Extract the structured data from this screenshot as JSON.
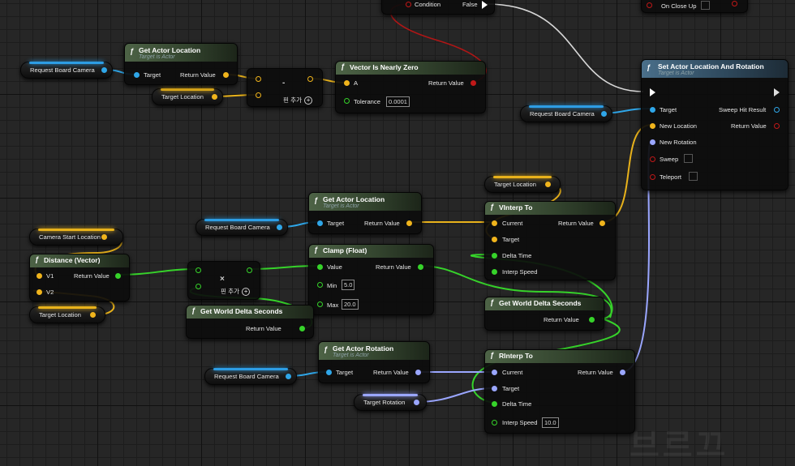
{
  "graph": {
    "n_getloc1": {
      "title": "Get Actor Location",
      "subtitle": "Target is Actor",
      "in_target": "Target",
      "out_return": "Return Value"
    },
    "n_add1": {
      "label": "핀 추가"
    },
    "n_nearlyzero": {
      "title": "Vector Is Nearly Zero",
      "in_a": "A",
      "in_tol": "Tolerance",
      "tol_value": "0.0001",
      "out_return": "Return Value"
    },
    "n_branch": {
      "condition": "Condition",
      "false": "False"
    },
    "n_close": {
      "label": "On Close Up"
    },
    "n_setloc": {
      "title": "Set Actor Location And Rotation",
      "subtitle": "Target is Actor",
      "target": "Target",
      "new_location": "New Location",
      "new_rotation": "New Rotation",
      "sweep": "Sweep",
      "teleport": "Teleport",
      "sweep_hit": "Sweep Hit Result",
      "return": "Return Value"
    },
    "n_getloc2": {
      "title": "Get Actor Location",
      "subtitle": "Target is Actor",
      "in_target": "Target",
      "out_return": "Return Value"
    },
    "n_vinterp": {
      "title": "VInterp To",
      "current": "Current",
      "target": "Target",
      "delta": "Delta Time",
      "speed": "Interp Speed",
      "return": "Return Value"
    },
    "n_distance": {
      "title": "Distance (Vector)",
      "v1": "V1",
      "v2": "V2",
      "return": "Return Value"
    },
    "n_add2": {
      "label": "핀 추가"
    },
    "n_clamp": {
      "title": "Clamp (Float)",
      "value": "Value",
      "min": "Min",
      "min_value": "5.0",
      "max": "Max",
      "max_value": "20.0",
      "return": "Return Value"
    },
    "n_delta1": {
      "title": "Get World Delta Seconds",
      "return": "Return Value"
    },
    "n_delta2": {
      "title": "Get World Delta Seconds",
      "return": "Return Value"
    },
    "n_getrot": {
      "title": "Get Actor Rotation",
      "subtitle": "Target is Actor",
      "target": "Target",
      "return": "Return Value"
    },
    "n_rinterp": {
      "title": "RInterp To",
      "current": "Current",
      "target": "Target",
      "delta": "Delta Time",
      "speed": "Interp Speed",
      "speed_value": "10.0",
      "return": "Return Value"
    }
  },
  "vars": {
    "request_board_camera": "Request Board Camera",
    "target_location": "Target Location",
    "camera_start_location": "Camera Start Location",
    "target_rotation": "Target Rotation"
  },
  "colors": {
    "vector": "#f0b41c",
    "object": "#2fa6e8",
    "float": "#36d32a",
    "rotator": "#9aa6ff",
    "bool": "#c01818"
  },
  "watermark": "브르끄"
}
